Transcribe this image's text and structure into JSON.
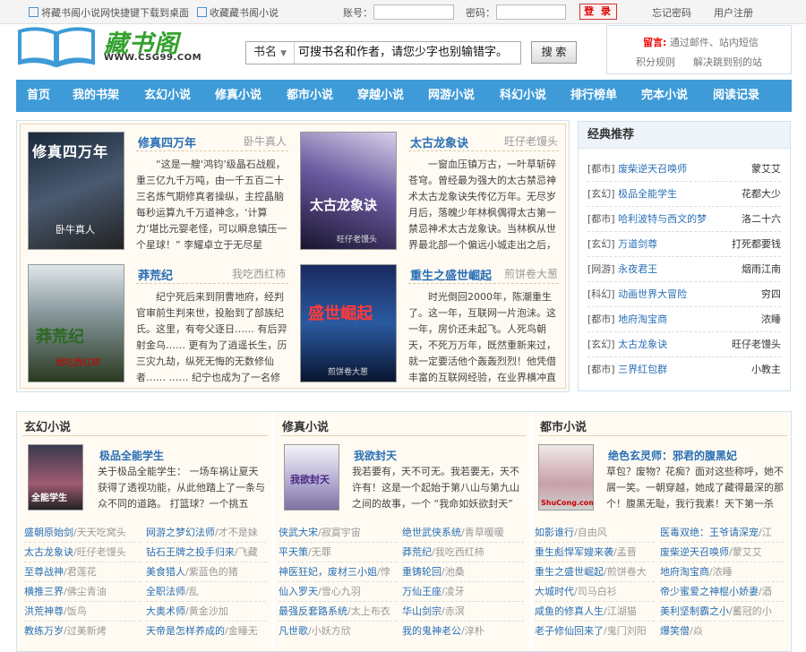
{
  "topbar": {
    "shortcut": "将藏书阁小说网快捷键下载到桌面",
    "favorite": "收藏藏书阁小说",
    "account_label": "账号：",
    "password_label": "密码：",
    "login_button": "登 录",
    "forgot_password": "忘记密码",
    "register": "用户注册"
  },
  "header": {
    "logo_text": "藏书阁",
    "logo_url": "WWW.CSG99.COM",
    "search_select": "书名",
    "search_value": "可搜书名和作者，请您少字也别输错字。",
    "search_button": "搜 索",
    "notice": {
      "label": "留言:",
      "line1": "通过邮件、站内短信",
      "line2a": "积分规则",
      "line2b": "解决跳到别的站"
    }
  },
  "nav": [
    "首页",
    "我的书架",
    "玄幻小说",
    "修真小说",
    "都市小说",
    "穿越小说",
    "网游小说",
    "科幻小说",
    "排行榜单",
    "完本小说",
    "阅读记录"
  ],
  "featured": [
    {
      "title": "修真四万年",
      "author": "卧牛真人",
      "desc": "“这是一艘‘鸿钧’级晶石战舰，重三亿九千万吨，由一千五百二十三名炼气期修真者操纵，主控晶脑每秒运算九千万道神念，‘计算力’堪比元婴老怪，可以瞬息镇压一个星球！” 李耀卓立于无尽星",
      "cover_text": "修真四万年",
      "cover_sub": "卧牛真人"
    },
    {
      "title": "太古龙象诀",
      "author": "旺仔老馒头",
      "desc": "一窗血压镇万古，一叶草斩碎苍穹。曾经最为强大的太古禁忌神术太古龙象诀失传亿万年。无尽岁月后，落魄少年林枫偶得太古第一禁忌神术太古龙象诀。当林枫从世界最北部一个偏远小城走出之后，",
      "cover_text": "太古龙象诀",
      "cover_sub": "旺仔老馒头"
    },
    {
      "title": "莽荒纪",
      "author": "我吃西红柿",
      "desc": "纪宁死后来到阴曹地府，经判官审前生判来世，投胎到了部族纪氏。这里，有夸父逐日…… 有后羿射金乌…… 更有为了逍遥长生，历三灾九劫，纵死无悔的无数修仙者…… …… 纪宁也成为了一名修",
      "cover_text": "莽荒纪",
      "cover_sub": "我吃西红柿"
    },
    {
      "title": "重生之盛世崛起",
      "author": "煎饼卷大葱",
      "desc": "时光倒回2000年，陈潮重生了。这一年，互联网一片泡沫。这一年，房价还未起飞。人死鸟朝天，不死万万年，既然重新来过，就一定要活他个轰轰烈烈！他凭借丰富的互联网经验，在业界横冲直",
      "cover_text": "盛世崛起",
      "cover_sub": "煎饼卷大葱"
    }
  ],
  "classic": {
    "title": "经典推荐",
    "items": [
      {
        "cat": "[都市]",
        "title": "废柴逆天召唤师",
        "author": "蒙艾艾"
      },
      {
        "cat": "[玄幻]",
        "title": "极品全能学生",
        "author": "花都大少"
      },
      {
        "cat": "[都市]",
        "title": "哈利波特与西文的梦",
        "author": "洛二十六"
      },
      {
        "cat": "[玄幻]",
        "title": "万道剑尊",
        "author": "打死都要钱"
      },
      {
        "cat": "[网游]",
        "title": "永夜君王",
        "author": "烟雨江南"
      },
      {
        "cat": "[科幻]",
        "title": "动画世界大冒险",
        "author": "穷四"
      },
      {
        "cat": "[都市]",
        "title": "地府淘宝商",
        "author": "浓睡"
      },
      {
        "cat": "[玄幻]",
        "title": "太古龙象诀",
        "author": "旺仔老馒头"
      },
      {
        "cat": "[都市]",
        "title": "三界红包群",
        "author": "小教主"
      }
    ]
  },
  "columns": [
    {
      "title": "玄幻小说",
      "feature_title": "极品全能学生",
      "feature_desc": "关于极品全能学生： 一场车祸让夏天获得了透视功能，从此他踏上了一条与众不同的道路。 打篮球？一个挑五个。 围棋",
      "cover_text": "全能学生",
      "items": [
        {
          "title": "盛朝原始剑",
          "author": "天天吃窝头"
        },
        {
          "title": "网游之梦幻法师",
          "author": "才不是妹"
        },
        {
          "title": "太古龙象诀",
          "author": "旺仔老馒头"
        },
        {
          "title": "钻石王牌之投手归来",
          "author": "飞藏"
        },
        {
          "title": "至尊战神",
          "author": "君莲花"
        },
        {
          "title": "美食猎人",
          "author": "紫蓝色的猪"
        },
        {
          "title": "横推三界",
          "author": "佛尘青油"
        },
        {
          "title": "全职法师",
          "author": "乱"
        },
        {
          "title": "洪荒神尊",
          "author": "饭鸟"
        },
        {
          "title": "大奥术师",
          "author": "黄金沙加"
        },
        {
          "title": "教练万岁",
          "author": "过美新烤"
        },
        {
          "title": "天帝是怎样养成的",
          "author": "金睡无"
        }
      ]
    },
    {
      "title": "修真小说",
      "feature_title": "我欲封天",
      "feature_desc": "我若要有，天不可无。我若要无，天不许有！这是一个起始于第八山与第九山之间的故事，一个 “我命如妖欲封天” 的世",
      "cover_text": "我欲封天",
      "items": [
        {
          "title": "侠武大宋",
          "author": "寂寞宇宙"
        },
        {
          "title": "绝世武侠系统",
          "author": "青草暖暖"
        },
        {
          "title": "平天策",
          "author": "无罪"
        },
        {
          "title": "莽荒纪",
          "author": "我吃西红柿"
        },
        {
          "title": "神医狂妃，废材三小姐",
          "author": "悖"
        },
        {
          "title": "重铸轮回",
          "author": "池桑"
        },
        {
          "title": "仙入罗天",
          "author": "雪心九羽"
        },
        {
          "title": "万仙王座",
          "author": "凌牙"
        },
        {
          "title": "最强反套路系统",
          "author": "太上布衣"
        },
        {
          "title": "华山剑宗",
          "author": "赤溟"
        },
        {
          "title": "凡世歌",
          "author": "小妖方欣"
        },
        {
          "title": "我的鬼神老公",
          "author": "淳朴"
        }
      ]
    },
    {
      "title": "都市小说",
      "feature_title": "绝色玄灵师：邪君的腹黑妃",
      "feature_desc": "草包？废物？花痴？面对这些称呼，她不屑一笑。一朝穿越，她成了藏得最深的那个！腹黑无耻，我行我素！天下第一杀",
      "cover_text": "ShuCong.com",
      "items": [
        {
          "title": "如影谁行",
          "author": "自由风"
        },
        {
          "title": "医毒双绝：王爷请深宠",
          "author": "江"
        },
        {
          "title": "重生彪悍军嫂来袭",
          "author": "孟晋"
        },
        {
          "title": "废柴逆天召唤师",
          "author": "蒙艾艾"
        },
        {
          "title": "重生之盛世崛起",
          "author": "煎饼卷大"
        },
        {
          "title": "地府淘宝商",
          "author": "浓睡"
        },
        {
          "title": "大城时代",
          "author": "司马白衫"
        },
        {
          "title": "帝少蜜爱之神棍小娇妻",
          "author": "酒"
        },
        {
          "title": "咸鱼的修真人生",
          "author": "江湖猫"
        },
        {
          "title": "美利坚制霸之小",
          "author": "蓄冠的小"
        },
        {
          "title": "老子修仙回来了",
          "author": "鬼门刘阳"
        },
        {
          "title": "爆笑僧",
          "author": "焱"
        }
      ]
    }
  ]
}
